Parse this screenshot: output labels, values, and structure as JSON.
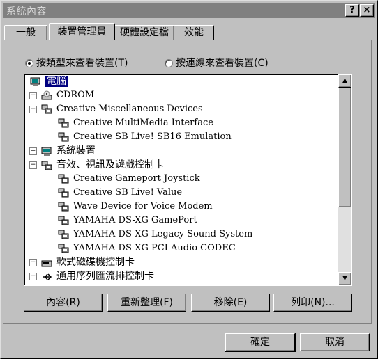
{
  "window": {
    "title": "系統內容",
    "help_label": "?",
    "close_label": "×"
  },
  "tabs": [
    {
      "label": "一般"
    },
    {
      "label": "裝置管理員"
    },
    {
      "label": "硬體設定檔"
    },
    {
      "label": "效能"
    }
  ],
  "view_options": {
    "by_type": "按類型來查看裝置(T)",
    "by_connection": "按連線來查看裝置(C)"
  },
  "tree": [
    {
      "label": "電腦",
      "icon": "computer-icon",
      "selected": true
    },
    {
      "label": "CDROM",
      "icon": "cdrom-icon",
      "toggle": "+"
    },
    {
      "label": "Creative Miscellaneous Devices",
      "icon": "device-icon",
      "toggle": "-"
    },
    {
      "label": "Creative MultiMedia Interface",
      "icon": "device-icon"
    },
    {
      "label": "Creative SB Live! SB16 Emulation",
      "icon": "device-icon"
    },
    {
      "label": "系統裝置",
      "icon": "computer-icon",
      "toggle": "+"
    },
    {
      "label": "音效、視訊及遊戲控制卡",
      "icon": "device-icon",
      "toggle": "-"
    },
    {
      "label": "Creative Gameport Joystick",
      "icon": "device-icon"
    },
    {
      "label": "Creative SB Live! Value",
      "icon": "device-icon"
    },
    {
      "label": "Wave Device for Voice Modem",
      "icon": "device-icon"
    },
    {
      "label": "YAMAHA DS-XG GamePort",
      "icon": "device-icon"
    },
    {
      "label": "YAMAHA DS-XG Legacy Sound System",
      "icon": "device-icon"
    },
    {
      "label": "YAMAHA DS-XG PCI Audio CODEC",
      "icon": "device-icon"
    },
    {
      "label": "軟式磁碟機控制卡",
      "icon": "floppy-controller-icon",
      "toggle": "+"
    },
    {
      "label": "通用序列匯流排控制卡",
      "icon": "usb-icon",
      "toggle": "+"
    },
    {
      "label": "滑鼠",
      "icon": "mouse-icon"
    }
  ],
  "actions": {
    "properties": "內容(R)",
    "refresh": "重新整理(F)",
    "remove": "移除(E)",
    "print": "列印(N)..."
  },
  "dialog": {
    "ok": "確定",
    "cancel": "取消"
  },
  "colors": {
    "selection": "#000080",
    "face": "#c0c0c0",
    "titlebar_inactive": "#808080"
  }
}
